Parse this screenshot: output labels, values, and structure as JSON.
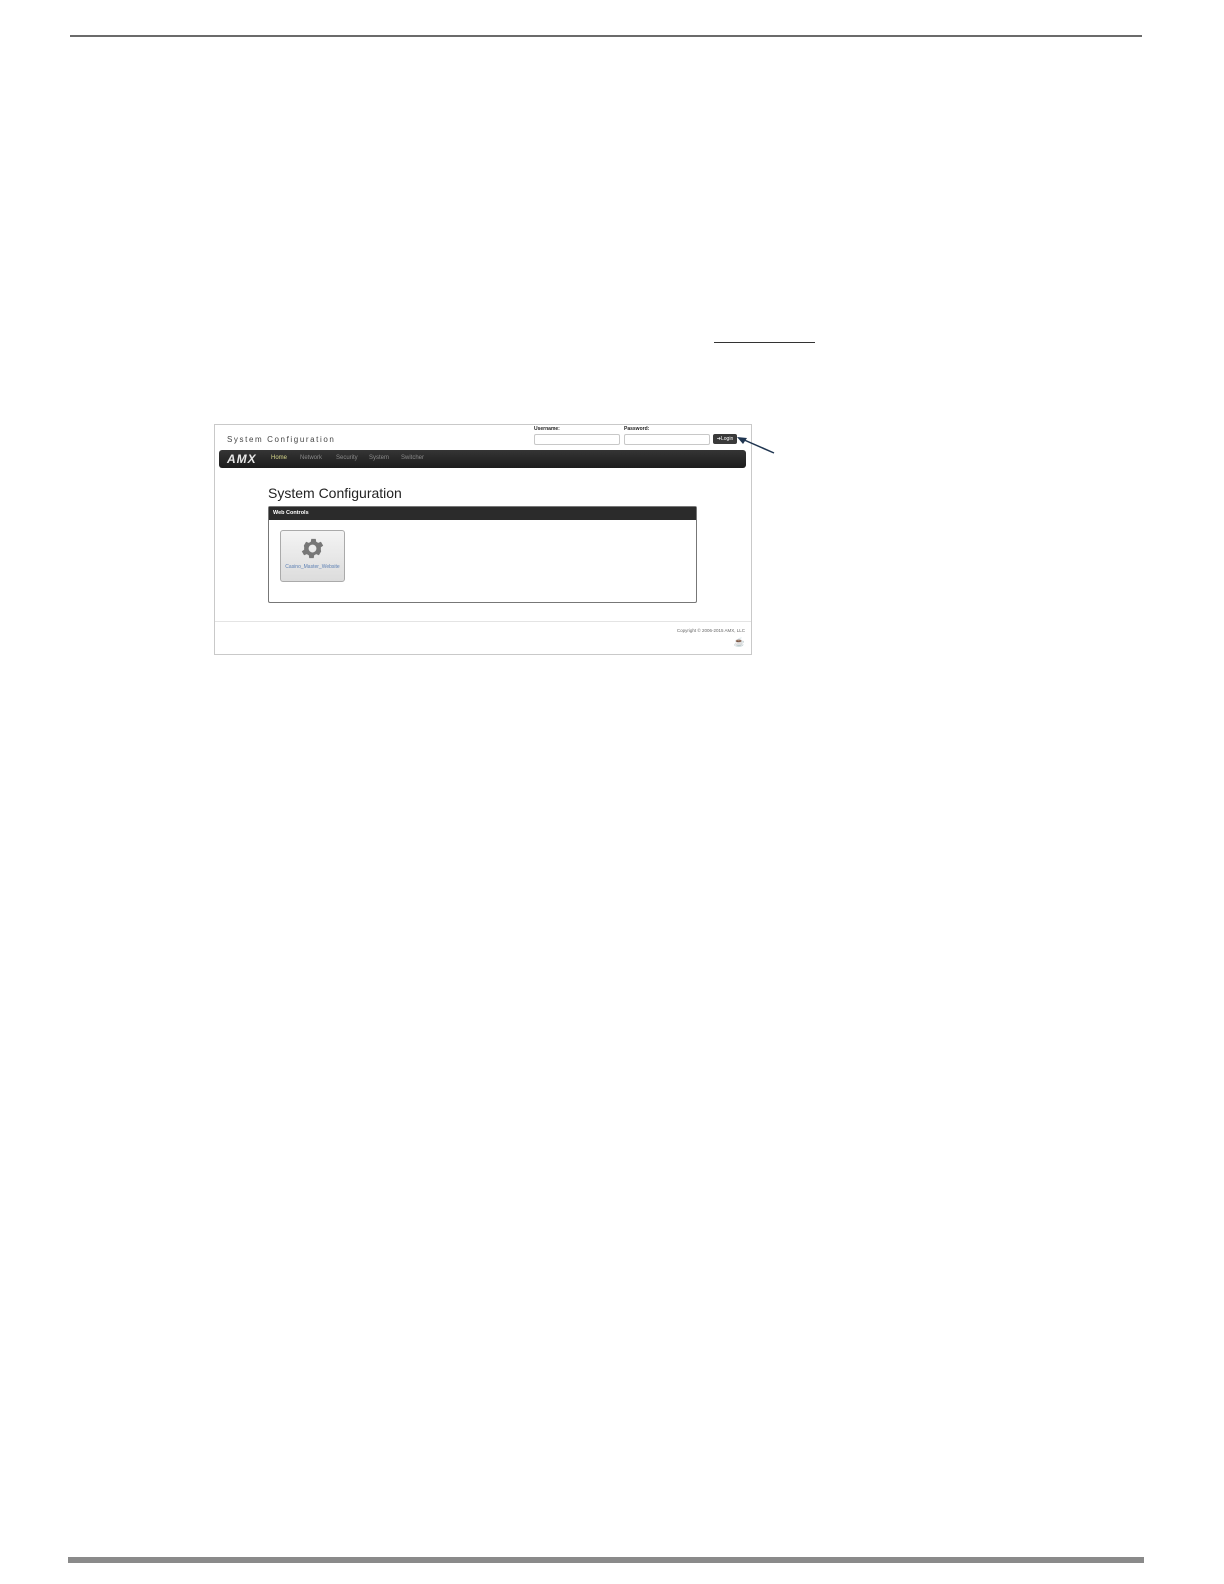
{
  "screenshot": {
    "header_title": "System Configuration",
    "username_label": "Username:",
    "password_label": "Password:",
    "login_label": "Login",
    "logo": "AMX",
    "nav": [
      "Home",
      "Network",
      "Security",
      "System",
      "Switcher"
    ],
    "page_heading": "System Configuration",
    "panel_title": "Web Controls",
    "tile_label": "Casino_Master_Website",
    "copyright": "Copyright © 2006-2015 AMX, LLC",
    "icons": {
      "login": "login-arrow-icon",
      "tile": "gear-icon",
      "java": "java-icon"
    }
  },
  "colors": {
    "navbar": "#2b2b2b",
    "active_nav": "#d9d98c",
    "tile_link": "#5b7fb3",
    "callout_arrow": "#1f3550"
  }
}
